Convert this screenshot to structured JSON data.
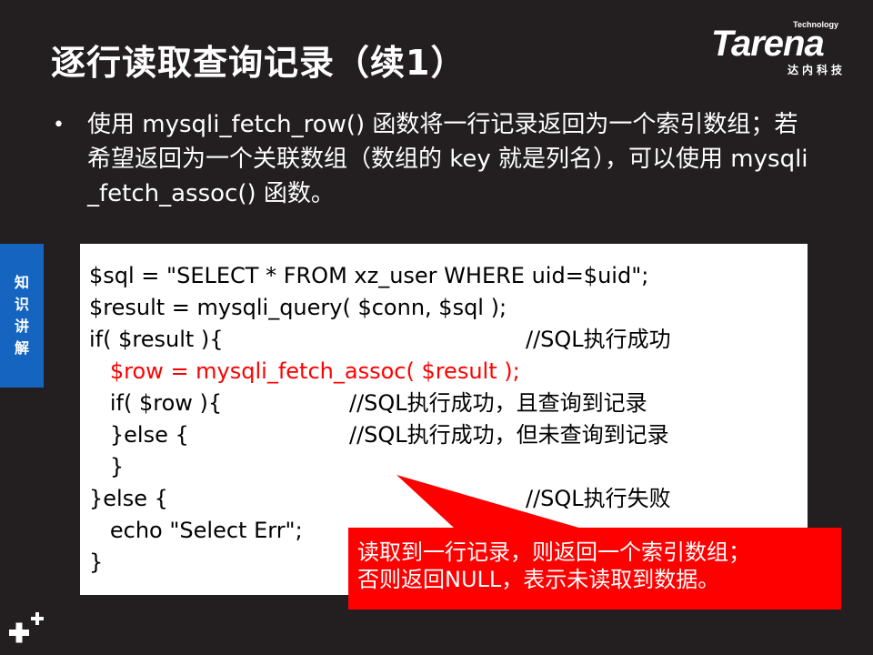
{
  "title": "逐行读取查询记录（续1）",
  "logo": {
    "tech_label": "Technology",
    "brand_name": "Tarena",
    "sub_label": "达内科技"
  },
  "bullet": {
    "marker": "•",
    "text": "使用 mysqli_fetch_row() 函数将一行记录返回为一个索引数组；若希望返回为一个关联数组（数组的 key 就是列名），可以使用 mysqli_fetch_assoc() 函数。"
  },
  "side_tab": {
    "chars": [
      "知",
      "识",
      "讲",
      "解"
    ]
  },
  "code": {
    "lines": [
      {
        "text": "$sql = \"SELECT * FROM xz_user WHERE uid=$uid\";",
        "color": "#000000"
      },
      {
        "text": "$result = mysqli_query( $conn, $sql );",
        "color": "#000000"
      },
      {
        "text": "if( $result ){",
        "color": "#000000"
      },
      {
        "text": "   $row = mysqli_fetch_assoc( $result );",
        "color": "#ff0000"
      },
      {
        "text": "   if( $row ){",
        "color": "#000000"
      },
      {
        "text": "   }else {",
        "color": "#000000"
      },
      {
        "text": "   }",
        "color": "#000000"
      },
      {
        "text": "}else {",
        "color": "#000000"
      },
      {
        "text": "   echo \"Select Err\";",
        "color": "#000000"
      },
      {
        "text": "}",
        "color": "#000000"
      }
    ],
    "comments": [
      {
        "text": "//SQL执行成功"
      },
      {
        "text": "//SQL执行成功，且查询到记录"
      },
      {
        "text": "//SQL执行成功，但未查询到记录"
      },
      {
        "text": "//SQL执行失败"
      }
    ]
  },
  "callout": {
    "line1": "读取到一行记录，则返回一个索引数组；",
    "line2": "否则返回NULL，表示未读取到数据。",
    "color": "#ff0000"
  },
  "colors": {
    "background": "#231f20",
    "side_tab": "#1565c0",
    "code_background": "#ffffff"
  }
}
